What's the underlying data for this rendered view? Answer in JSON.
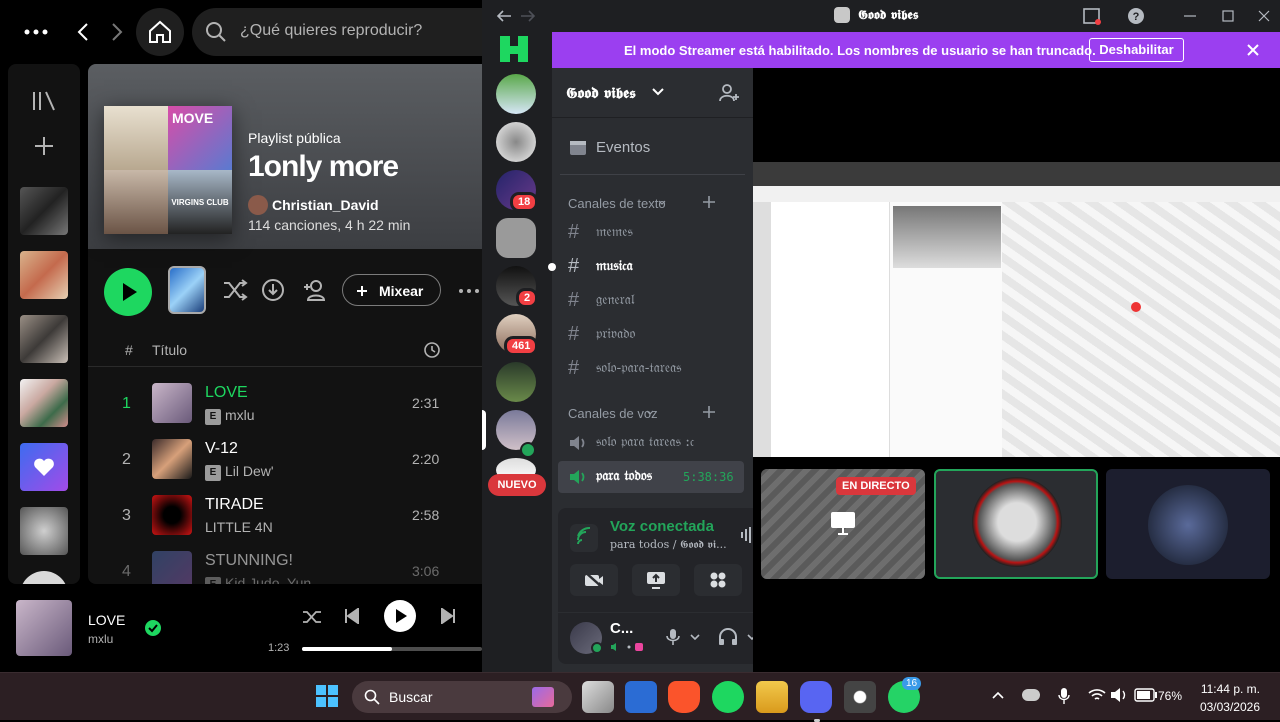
{
  "spotify": {
    "search_placeholder": "¿Qué quieres reproducir?",
    "playlist": {
      "type": "Playlist pública",
      "title": "1only more",
      "owner": "Christian_David",
      "stats": "114 canciones, 4 h 22 min",
      "cover_texts": [
        "MOVE",
        "VIRGINS CLUB"
      ]
    },
    "actions": {
      "mix_label": "Mixear"
    },
    "columns": {
      "number": "#",
      "title": "Título"
    },
    "tracks": [
      {
        "num": "1",
        "title": "LOVE",
        "artist": "mxlu",
        "explicit": true,
        "duration": "2:31",
        "playing": true
      },
      {
        "num": "2",
        "title": "V-12",
        "artist": "Lil Dew'",
        "explicit": true,
        "duration": "2:20",
        "playing": false
      },
      {
        "num": "3",
        "title": "TIRADE",
        "artist": "LITTLE 4N",
        "explicit": false,
        "duration": "2:58",
        "playing": false
      },
      {
        "num": "4",
        "title": "STUNNING!",
        "artist": "Kid Judo, Yun",
        "explicit": true,
        "duration": "3:06",
        "playing": false
      }
    ],
    "explicit_badge": "E",
    "now_playing": {
      "title": "LOVE",
      "artist": "mxlu",
      "elapsed": "1:23",
      "progress": 0.5
    },
    "colors": {
      "accent": "#1ed760"
    }
  },
  "discord": {
    "window_title": "𝕲𝖔𝖔𝖉 𝖛𝖎𝖇𝖊𝖘",
    "banner": {
      "text": "El modo Streamer está habilitado. Los nombres de usuario se han truncado.",
      "button": "Deshabilitar"
    },
    "server_name": "𝕲𝖔𝖔𝖉 𝖛𝖎𝖇𝖊𝖘",
    "guild_badges": [
      "18",
      "2",
      "461"
    ],
    "new_label": "NUEVO",
    "events_label": "Eventos",
    "text_category": "Canales de texto",
    "text_channels": [
      "𝔪𝔢𝔪𝔢𝔰",
      "𝔪𝔲𝔰𝔦𝔠𝔞",
      "𝔤𝔢𝔫𝔢𝔯𝔞𝔩",
      "𝔭𝔯𝔦𝔳𝔞𝔡𝔬",
      "𝔰𝔬𝔩𝔬-𝔭𝔞𝔯𝔞-𝔱𝔞𝔯𝔢𝔞𝔰"
    ],
    "voice_category": "Canales de voz",
    "voice_channels": [
      {
        "name": "𝔰𝔬𝔩𝔬 𝔭𝔞𝔯𝔞 𝔱𝔞𝔯𝔢𝔞𝔰 :𝔠",
        "time": ""
      },
      {
        "name": "𝔭𝔞𝔯𝔞 𝔱𝔬𝔡𝔬𝔰",
        "time": "5:38:36"
      }
    ],
    "voice_status": {
      "title": "Voz conectada",
      "subtitle": "para todos / 𝕲𝖔𝖔𝖉 𝖛𝖎..."
    },
    "user": {
      "name": "C..."
    },
    "live_label": "EN DIRECTO",
    "colors": {
      "banner": "#9b3ff0",
      "connected": "#23a55a",
      "live": "#da373c"
    }
  },
  "taskbar": {
    "search_label": "Buscar",
    "battery": "76%",
    "time": "11:44 p. m.",
    "date": "03/03/2026",
    "whatsapp_badge": "16"
  }
}
